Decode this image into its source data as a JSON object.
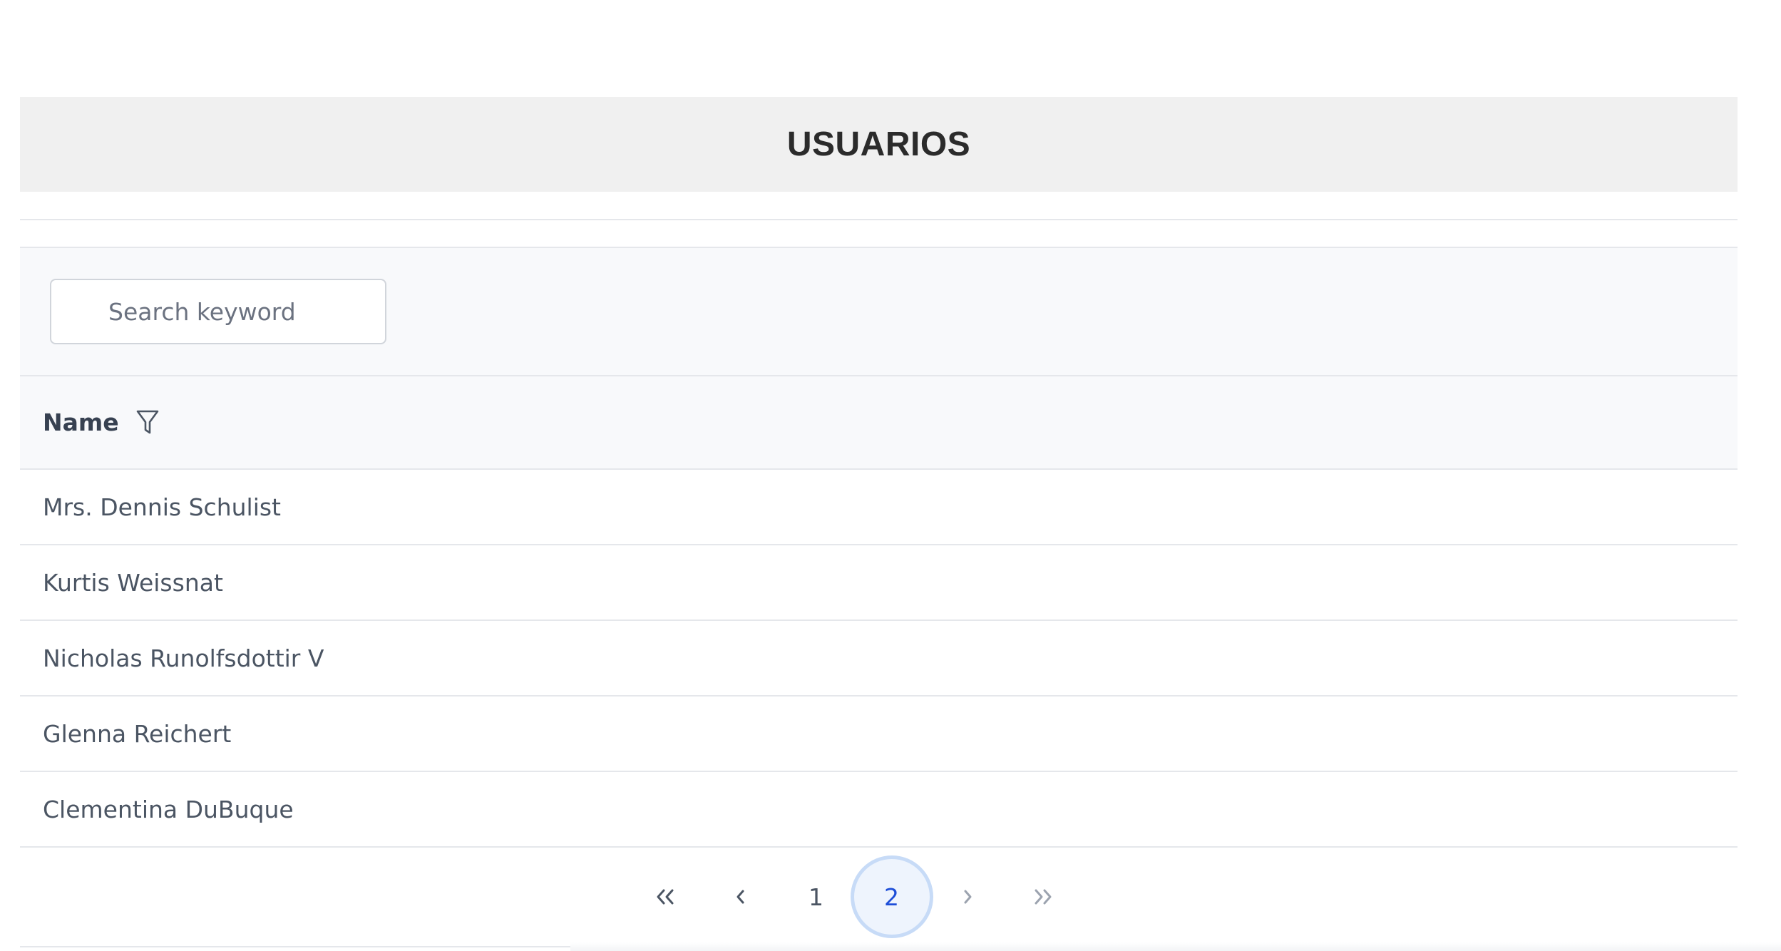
{
  "header": {
    "title": "USUARIOS"
  },
  "search": {
    "placeholder": "Search keyword",
    "value": ""
  },
  "table": {
    "columns": [
      {
        "label": "Name",
        "filter_icon": "filter-funnel-icon"
      }
    ],
    "rows": [
      {
        "name": "Mrs. Dennis Schulist"
      },
      {
        "name": "Kurtis Weissnat"
      },
      {
        "name": "Nicholas Runolfsdottir V"
      },
      {
        "name": "Glenna Reichert"
      },
      {
        "name": "Clementina DuBuque"
      }
    ]
  },
  "pagination": {
    "pages": [
      "1",
      "2"
    ],
    "current_page": "2",
    "first_icon": "double-chevron-left-icon",
    "prev_icon": "chevron-left-icon",
    "next_icon": "chevron-right-icon",
    "last_icon": "double-chevron-right-icon"
  },
  "colors": {
    "title_bar_bg": "#f0f0f0",
    "active_page_bg": "#eef4fd",
    "active_page_text": "#1d4ed8",
    "active_page_ring": "#c7dbf7"
  }
}
